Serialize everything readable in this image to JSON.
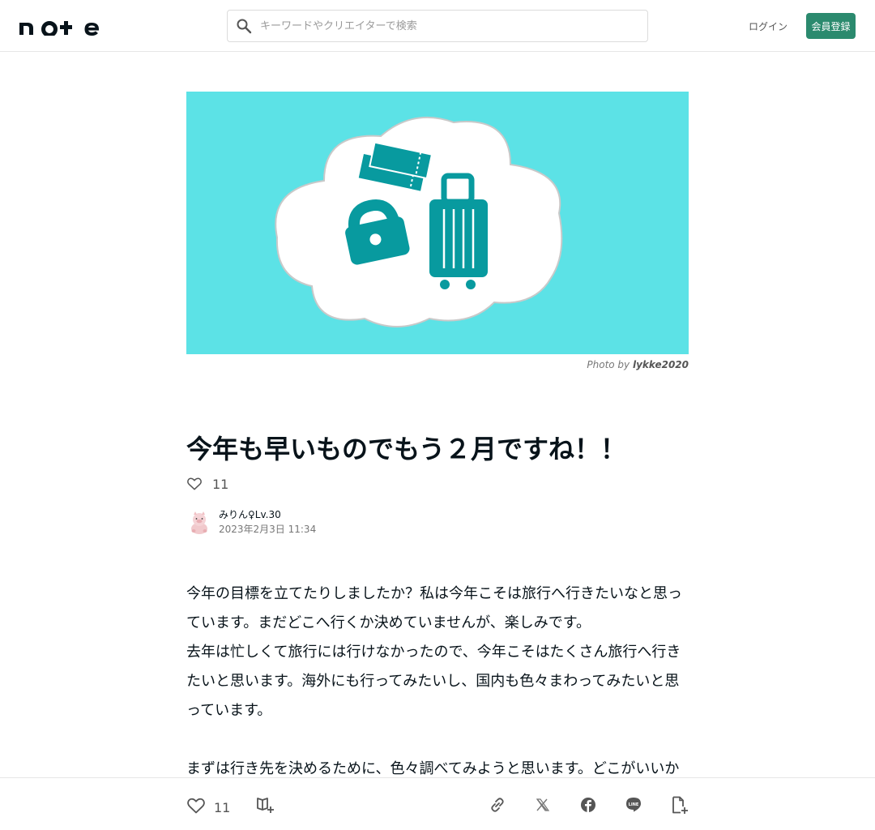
{
  "header": {
    "logo_text": "note",
    "search_placeholder": "キーワードやクリエイターで検索",
    "login_label": "ログイン",
    "signup_label": "会員登録"
  },
  "hero": {
    "background_color": "#5ce2e6",
    "icons": [
      "cloud",
      "tickets-icon",
      "handbag-icon",
      "suitcase-icon"
    ],
    "credit_prefix": "Photo by",
    "credit_author": "lykke2020"
  },
  "article": {
    "title": "今年も早いものでもう２月ですね！！",
    "like_count": "11",
    "author_name": "みりん♀Lv.30",
    "date": "2023年2月3日 11:34",
    "paragraphs": [
      "今年の目標を立てたりしましたか？私は今年こそは旅行へ行きたいなと思っています。まだどこへ行くか決めていませんが、楽しみです。",
      "去年は忙しくて旅行には行けなかったので、今年こそはたくさん旅行へ行きたいと思います。海外にも行ってみたいし、国内も色々まわってみたいと思っています。",
      "",
      "まずは行き先を決めるために、色々調べてみようと思います。どこがいいかな…！"
    ]
  },
  "bottom_bar": {
    "like_count": "11",
    "icons": [
      "heart-icon",
      "magazine-add-icon",
      "link-icon",
      "x-icon",
      "facebook-icon",
      "line-icon",
      "note-add-icon"
    ]
  },
  "colors": {
    "brand_green": "#2b8a6e",
    "hero_cyan": "#5ce2e6",
    "icon_teal": "#089a9f"
  }
}
